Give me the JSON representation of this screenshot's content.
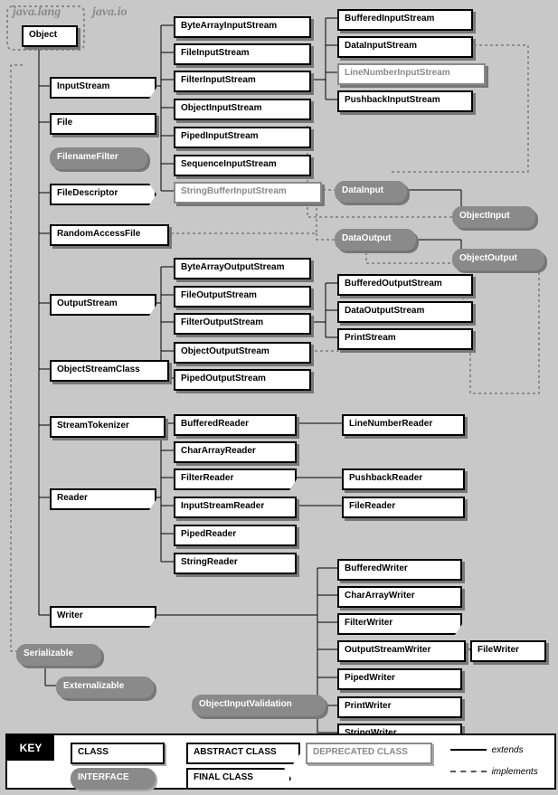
{
  "pkg1": "java.lang",
  "pkg2": "java.io",
  "n": {
    "Object": "Object",
    "InputStream": "InputStream",
    "File": "File",
    "FilenameFilter": "FilenameFilter",
    "FileDescriptor": "FileDescriptor",
    "RandomAccessFile": "RandomAccessFile",
    "OutputStream": "OutputStream",
    "ObjectStreamClass": "ObjectStreamClass",
    "StreamTokenizer": "StreamTokenizer",
    "Reader": "Reader",
    "Writer": "Writer",
    "Serializable": "Serializable",
    "Externalizable": "Externalizable",
    "ByteArrayInputStream": "ByteArrayInputStream",
    "FileInputStream": "FileInputStream",
    "FilterInputStream": "FilterInputStream",
    "ObjectInputStream": "ObjectInputStream",
    "PipedInputStream": "PipedInputStream",
    "SequenceInputStream": "SequenceInputStream",
    "StringBufferInputStream": "StringBufferInputStream",
    "BufferedInputStream": "BufferedInputStream",
    "DataInputStream": "DataInputStream",
    "LineNumberInputStream": "LineNumberInputStream",
    "PushbackInputStream": "PushbackInputStream",
    "DataInput": "DataInput",
    "ObjectInput": "ObjectInput",
    "DataOutput": "DataOutput",
    "ObjectOutput": "ObjectOutput",
    "ByteArrayOutputStream": "ByteArrayOutputStream",
    "FileOutputStream": "FileOutputStream",
    "FilterOutputStream": "FilterOutputStream",
    "ObjectOutputStream": "ObjectOutputStream",
    "PipedOutputStream": "PipedOutputStream",
    "BufferedOutputStream": "BufferedOutputStream",
    "DataOutputStream": "DataOutputStream",
    "PrintStream": "PrintStream",
    "BufferedReader": "BufferedReader",
    "CharArrayReader": "CharArrayReader",
    "FilterReader": "FilterReader",
    "InputStreamReader": "InputStreamReader",
    "PipedReader": "PipedReader",
    "StringReader": "StringReader",
    "LineNumberReader": "LineNumberReader",
    "PushbackReader": "PushbackReader",
    "FileReader": "FileReader",
    "BufferedWriter": "BufferedWriter",
    "CharArrayWriter": "CharArrayWriter",
    "FilterWriter": "FilterWriter",
    "OutputStreamWriter": "OutputStreamWriter",
    "PipedWriter": "PipedWriter",
    "PrintWriter": "PrintWriter",
    "StringWriter": "StringWriter",
    "FileWriter": "FileWriter",
    "ObjectInputValidation": "ObjectInputValidation"
  },
  "key": {
    "hdr": "KEY",
    "class": "CLASS",
    "abs": "ABSTRACT CLASS",
    "dep": "DEPRECATED CLASS",
    "iface": "INTERFACE",
    "final": "FINAL CLASS",
    "ext": "extends",
    "imp": "implements"
  }
}
